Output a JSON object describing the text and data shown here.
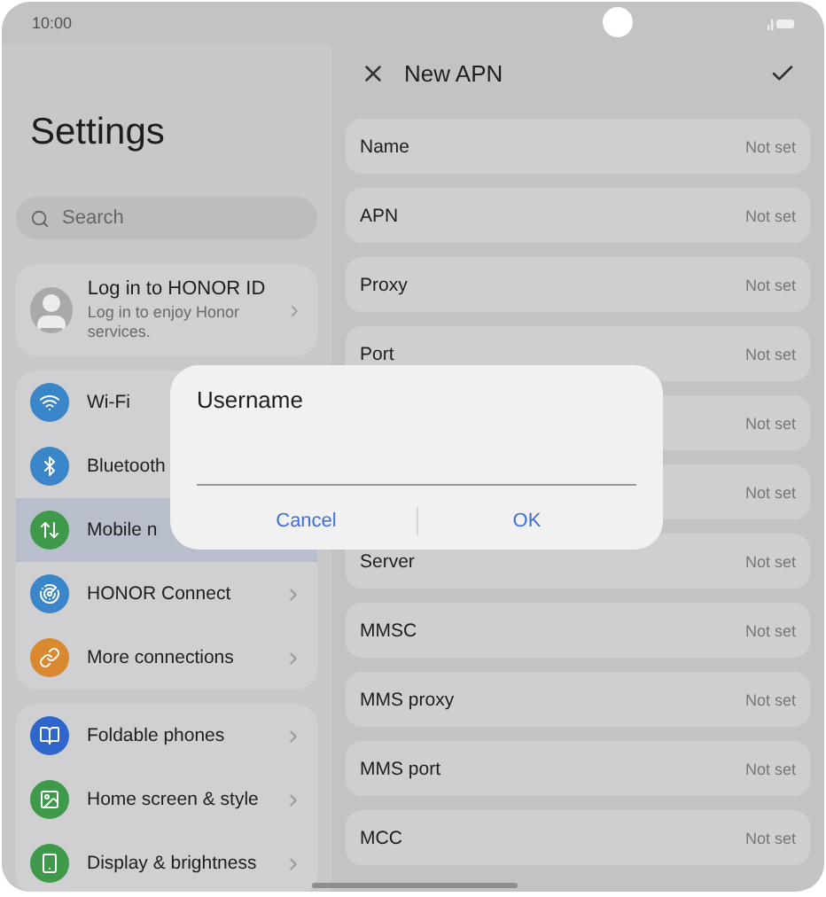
{
  "status_bar": {
    "time": "10:00"
  },
  "sidebar": {
    "title": "Settings",
    "search": {
      "placeholder": "Search"
    },
    "account": {
      "title": "Log in to HONOR ID",
      "subtitle": "Log in to enjoy Honor services."
    },
    "groups": [
      {
        "items": [
          {
            "label": "Wi-Fi",
            "selected": false
          },
          {
            "label": "Bluetooth",
            "selected": false
          },
          {
            "label": "Mobile n",
            "selected": true
          },
          {
            "label": "HONOR Connect",
            "selected": false
          },
          {
            "label": "More connections",
            "selected": false
          }
        ]
      },
      {
        "items": [
          {
            "label": "Foldable phones",
            "selected": false
          },
          {
            "label": "Home screen & style",
            "selected": false
          },
          {
            "label": "Display & brightness",
            "selected": false
          }
        ]
      }
    ]
  },
  "detail": {
    "title": "New APN",
    "fields": [
      {
        "label": "Name",
        "value": "Not set"
      },
      {
        "label": "APN",
        "value": "Not set"
      },
      {
        "label": "Proxy",
        "value": "Not set"
      },
      {
        "label": "Port",
        "value": "Not set"
      },
      {
        "value": "Not set"
      },
      {
        "value": "Not set"
      },
      {
        "label": "Server",
        "value": "Not set"
      },
      {
        "label": "MMSC",
        "value": "Not set"
      },
      {
        "label": "MMS proxy",
        "value": "Not set"
      },
      {
        "label": "MMS port",
        "value": "Not set"
      },
      {
        "label": "MCC",
        "value": "Not set"
      }
    ]
  },
  "dialog": {
    "title": "Username",
    "buttons": [
      "Cancel",
      "OK"
    ]
  }
}
